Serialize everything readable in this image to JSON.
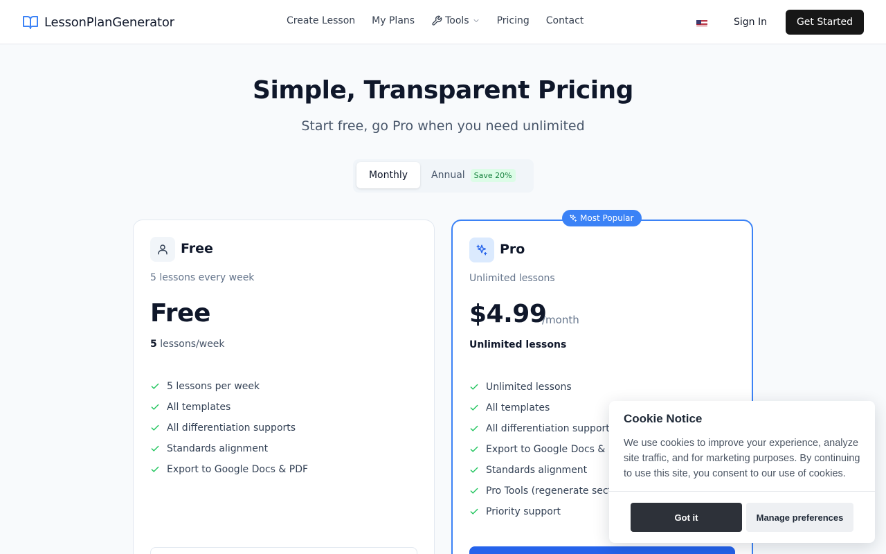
{
  "header": {
    "logo_text": "LessonPlanGenerator",
    "nav": [
      "Create Lesson",
      "My Plans",
      "Tools",
      "Pricing",
      "Contact"
    ],
    "language_flag": "us-flag-icon",
    "sign_in": "Sign In",
    "get_started": "Get Started"
  },
  "hero": {
    "title": "Simple, Transparent Pricing",
    "subtitle": "Start free, go Pro when you need unlimited"
  },
  "billing_toggle": {
    "monthly": "Monthly",
    "annual": "Annual",
    "save_badge": "Save 20%",
    "selected": "Monthly"
  },
  "plans": {
    "free": {
      "name": "Free",
      "description": "5 lessons every week",
      "price": "Free",
      "quota_number": "5",
      "quota_text": "lessons/week",
      "features": [
        "5 lessons per week",
        "All templates",
        "All differentiation supports",
        "Standards alignment",
        "Export to Google Docs & PDF"
      ]
    },
    "pro": {
      "badge": "Most Popular",
      "name": "Pro",
      "description": "Unlimited lessons",
      "price": "$4.99",
      "period": "/month",
      "quota": "Unlimited lessons",
      "features": [
        "Unlimited lessons",
        "All templates",
        "All differentiation supports",
        "Export to Google Docs & PDF",
        "Standards alignment",
        "Pro Tools (regenerate sect",
        "Priority support"
      ]
    }
  },
  "cookie": {
    "title": "Cookie Notice",
    "text": "We use cookies to improve your experience, analyze site traffic, and for marketing purposes. By continuing to use this site, you consent to our use of cookies.",
    "accept": "Got it",
    "manage": "Manage preferences"
  },
  "colors": {
    "accent": "#3b82f6",
    "check": "#22c55e",
    "primary_button": "#171717"
  }
}
